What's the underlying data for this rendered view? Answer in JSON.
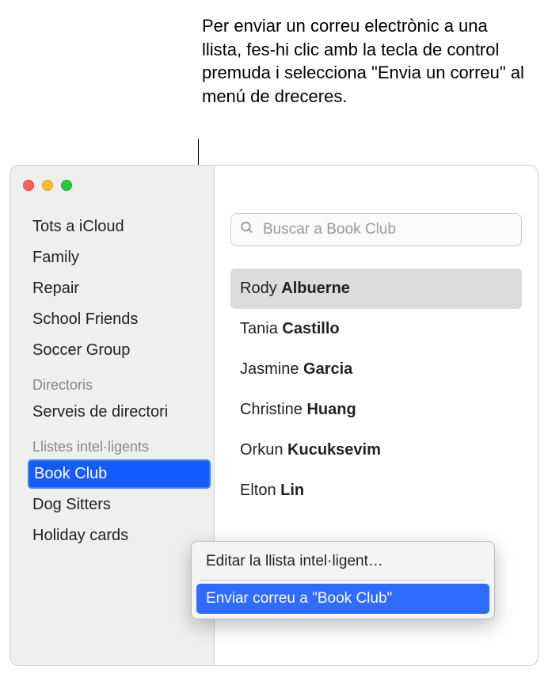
{
  "callout": "Per enviar un correu electrònic a una llista, fes-hi clic amb la tecla de control premuda i selecciona \"Envia un correu\" al menú de dreceres.",
  "sidebar": {
    "groups": [
      "Tots a iCloud",
      "Family",
      "Repair",
      "School Friends",
      "Soccer Group"
    ],
    "directories_header": "Directoris",
    "directories": [
      "Serveis de directori"
    ],
    "smart_header": "Llistes intel·ligents",
    "smart": [
      "Book Club",
      "Dog Sitters",
      "Holiday cards"
    ],
    "selected_smart": "Book Club"
  },
  "search": {
    "placeholder": "Buscar a Book Club"
  },
  "contacts": [
    {
      "first": "Rody",
      "last": "Albuerne",
      "highlight": true
    },
    {
      "first": "Tania",
      "last": "Castillo",
      "highlight": false
    },
    {
      "first": "Jasmine",
      "last": "Garcia",
      "highlight": false
    },
    {
      "first": "Christine",
      "last": "Huang",
      "highlight": false
    },
    {
      "first": "Orkun",
      "last": "Kucuksevim",
      "highlight": false
    },
    {
      "first": "Elton",
      "last": "Lin",
      "highlight": false
    }
  ],
  "context_menu": {
    "edit": "Editar la llista intel·ligent…",
    "send": "Enviar correu a \"Book Club\""
  }
}
